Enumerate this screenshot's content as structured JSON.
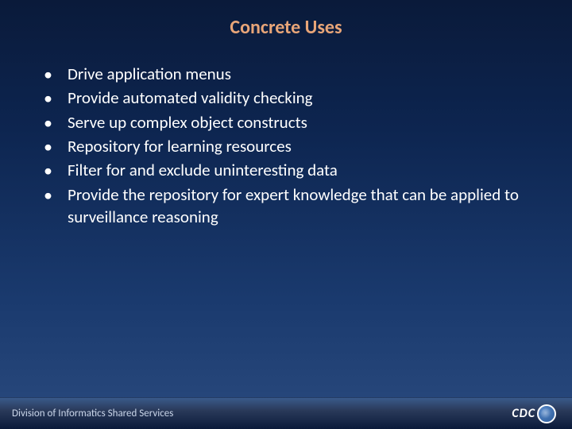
{
  "title": "Concrete Uses",
  "bullets": [
    "Drive application menus",
    "Provide automated validity checking",
    "Serve up complex object constructs",
    "Repository for learning resources",
    "Filter for and exclude uninteresting data",
    "Provide the repository for expert knowledge that can be applied to surveillance reasoning"
  ],
  "footer": {
    "division": "Division of Informatics Shared Services",
    "logo": "CDC"
  }
}
